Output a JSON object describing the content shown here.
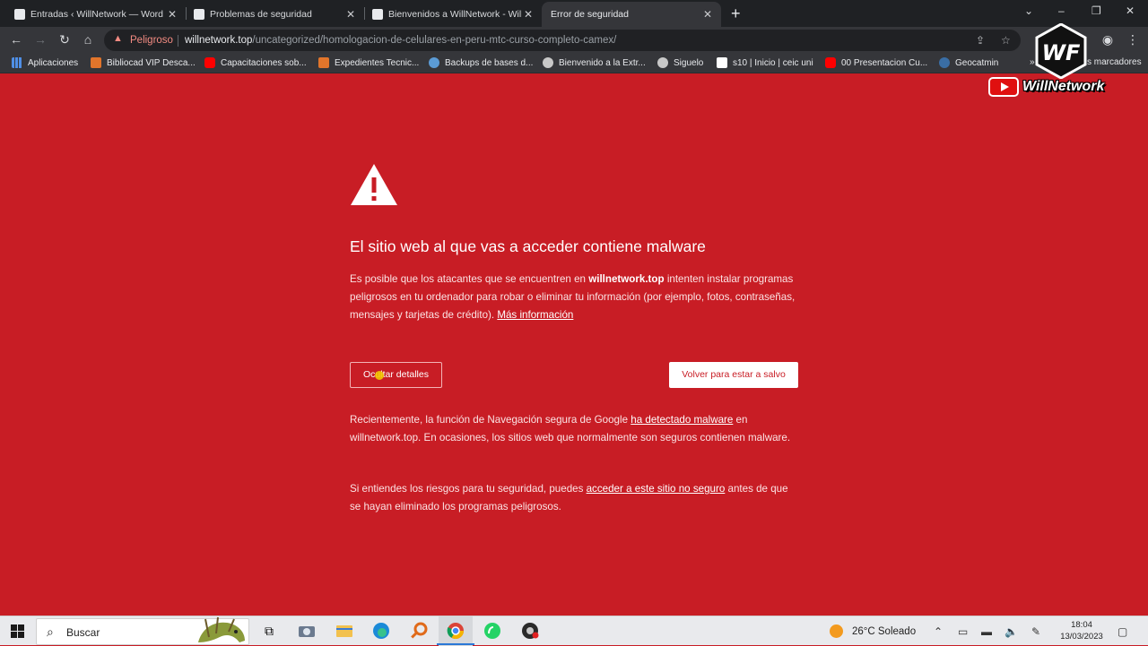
{
  "tabs": [
    {
      "title": "Entradas ‹ WillNetwork — Word",
      "favicon_color": "#e8eaed",
      "active": false
    },
    {
      "title": "Problemas de seguridad",
      "favicon_color": "#e8eaed",
      "active": false
    },
    {
      "title": "Bienvenidos a WillNetwork - Will",
      "favicon_color": "#e8eaed",
      "active": false
    },
    {
      "title": "Error de seguridad",
      "active": true
    }
  ],
  "toolbar": {
    "status": "Peligroso",
    "url_host": "willnetwork.top",
    "url_path": "/uncategorized/homologacion-de-celulares-en-peru-mtc-curso-completo-camex/"
  },
  "bookmarks": [
    {
      "label": "Aplicaciones",
      "icon": "apps-grid-icon",
      "color": "#4f8fe6"
    },
    {
      "label": "Bibliocad VIP Desca...",
      "icon": "bibliocad-icon",
      "color": "#e2752b"
    },
    {
      "label": "Capacitaciones sob...",
      "icon": "youtube-icon",
      "color": "#ff0000"
    },
    {
      "label": "Expedientes Tecnic...",
      "icon": "bibliocad-icon",
      "color": "#e2752b"
    },
    {
      "label": "Backups de bases d...",
      "icon": "globe-icon",
      "color": "#5b9bd5"
    },
    {
      "label": "Bienvenido a la Extr...",
      "icon": "globe-icon",
      "color": "#c8c8c8"
    },
    {
      "label": "Siguelo",
      "icon": "globe-icon",
      "color": "#c8c8c8"
    },
    {
      "label": "s10 | Inicio | ceic uni",
      "icon": "s10-icon",
      "color": "#ffffff"
    },
    {
      "label": "00 Presentacion Cu...",
      "icon": "youtube-icon",
      "color": "#ff0000"
    },
    {
      "label": "Geocatmin",
      "icon": "geocatmin-icon",
      "color": "#3a6ea5"
    }
  ],
  "other_bookmarks": "s marcadores",
  "interstitial": {
    "title": "El sitio web al que vas a acceder contiene malware",
    "p1_before": "Es posible que los atacantes que se encuentren en ",
    "p1_host": "willnetwork.top",
    "p1_after": " intenten instalar programas peligrosos en tu ordenador para robar o eliminar tu información (por ejemplo, fotos, contraseñas, mensajes y tarjetas de crédito). ",
    "p1_link": "Más información",
    "details_button": "Ocultar detalles",
    "safe_button": "Volver para estar a salvo",
    "p2_before": "Recientemente, la función de Navegación segura de Google ",
    "p2_link": "ha detectado malware",
    "p2_after": " en willnetwork.top. En ocasiones, los sitios web que normalmente son seguros contienen malware.",
    "p3_before": "Si entiendes los riesgos para tu seguridad, puedes ",
    "p3_link": "acceder a este sitio no seguro",
    "p3_after": " antes de que se hayan eliminado los programas peligrosos."
  },
  "watermark": {
    "logo": "WF",
    "brand": "WillNetwork"
  },
  "taskbar": {
    "search_placeholder": "Buscar",
    "weather": "26°C  Soleado",
    "time": "18:04",
    "date": "13/03/2023"
  },
  "colors": {
    "page_bg": "#c81d25",
    "tab_bg": "#1f2124",
    "toolbar_bg": "#35363a"
  }
}
